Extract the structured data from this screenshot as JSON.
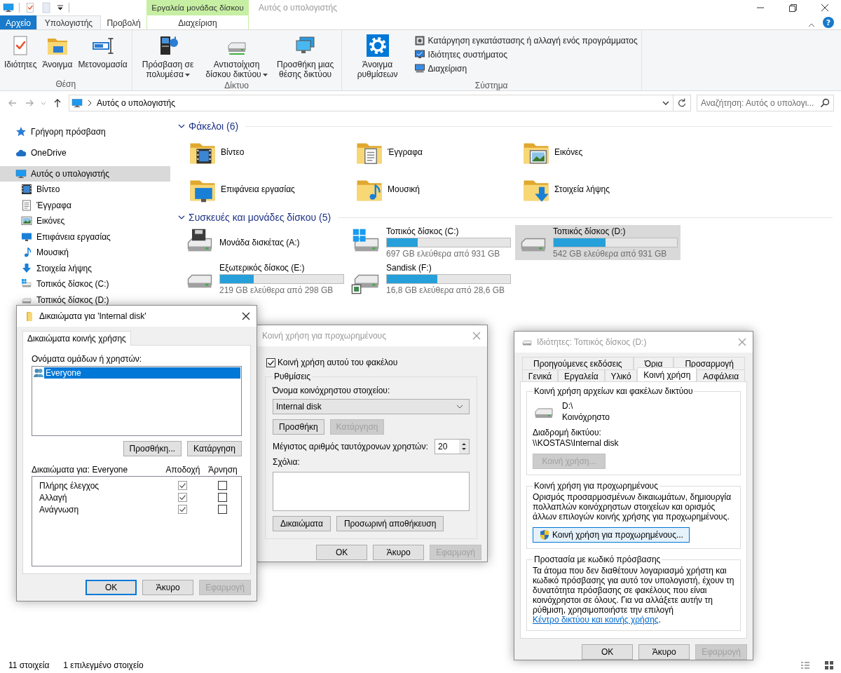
{
  "window": {
    "title": "Αυτός ο υπολογιστής",
    "tool_tab_group": "Εργαλεία μονάδας δίσκου",
    "help": "?"
  },
  "ribbon": {
    "tabs": [
      {
        "label": "Αρχείο",
        "kind": "file",
        "selected": false
      },
      {
        "label": "Υπολογιστής",
        "kind": "tab",
        "selected": true
      },
      {
        "label": "Προβολή",
        "kind": "tab",
        "selected": false
      },
      {
        "label": "Διαχείριση",
        "kind": "tool",
        "selected": false
      }
    ],
    "groups": [
      {
        "name": "Θέση",
        "commands": [
          {
            "label": "Ιδιότητες",
            "kind": "large",
            "dropdown": false
          },
          {
            "label": "Άνοιγμα",
            "kind": "large",
            "dropdown": false
          },
          {
            "label": "Μετονομασία",
            "kind": "large",
            "dropdown": false
          }
        ]
      },
      {
        "name": "Δίκτυο",
        "commands": [
          {
            "label": "Πρόσβαση σε πολυμέσα",
            "kind": "large",
            "dropdown": true
          },
          {
            "label": "Αντιστοίχιση δίσκου δικτύου",
            "kind": "large",
            "dropdown": true
          },
          {
            "label": "Προσθήκη μιας θέσης δικτύου",
            "kind": "large",
            "dropdown": false
          }
        ]
      },
      {
        "name": "Σύστημα",
        "commands": [
          {
            "label": "Άνοιγμα ρυθμίσεων",
            "kind": "large",
            "dropdown": false
          },
          {
            "label": "Κατάργηση εγκατάστασης ή αλλαγή ενός προγράμματος",
            "kind": "small"
          },
          {
            "label": "Ιδιότητες συστήματος",
            "kind": "small"
          },
          {
            "label": "Διαχείριση",
            "kind": "small"
          }
        ]
      }
    ]
  },
  "address_bar": {
    "path": "Αυτός ο υπολογιστής"
  },
  "search": {
    "placeholder": "Αναζήτηση: Αυτός ο υπολογι..."
  },
  "sidebar": {
    "items": [
      {
        "label": "Γρήγορη πρόσβαση",
        "selected": false
      },
      {
        "label": "OneDrive",
        "selected": false
      },
      {
        "label": "Αυτός ο υπολογιστής",
        "selected": true,
        "children": [
          {
            "label": "Βίντεο",
            "selected": false
          },
          {
            "label": "Έγγραφα",
            "selected": false
          },
          {
            "label": "Εικόνες",
            "selected": false
          },
          {
            "label": "Επιφάνεια εργασίας",
            "selected": false
          },
          {
            "label": "Μουσική",
            "selected": false
          },
          {
            "label": "Στοιχεία λήψης",
            "selected": false
          },
          {
            "label": "Τοπικός δίσκος (C:)",
            "selected": false
          },
          {
            "label": "Τοπικός δίσκος (D:)",
            "selected": false
          }
        ]
      }
    ]
  },
  "sections": [
    {
      "title": "Φάκελοι (6)",
      "kind": "folders",
      "items": [
        {
          "name": "Βίντεο"
        },
        {
          "name": "Έγγραφα"
        },
        {
          "name": "Εικόνες"
        },
        {
          "name": "Επιφάνεια εργασίας"
        },
        {
          "name": "Μουσική"
        },
        {
          "name": "Στοιχεία λήψης"
        }
      ]
    },
    {
      "title": "Συσκευές και μονάδες δίσκου (5)",
      "kind": "drives",
      "items": [
        {
          "name": "Μονάδα δισκέτας (A:)",
          "selected": false
        },
        {
          "name": "Τοπικός δίσκος (C:)",
          "level": 0.25,
          "free": "697 GB ελεύθερα από 931 GB",
          "selected": false
        },
        {
          "name": "Τοπικός δίσκος (D:)",
          "level": 0.42,
          "free": "542 GB ελεύθερα από 931 GB",
          "selected": true
        },
        {
          "name": "Εξωτερικός δίσκος (E:)",
          "level": 0.27,
          "free": "219 GB ελεύθερα από 298 GB",
          "selected": false
        },
        {
          "name": "Sandisk (F:)",
          "level": 0.41,
          "free": "16,8 GB ελεύθερα από 28,6 GB",
          "selected": false
        }
      ]
    }
  ],
  "status_bar": {
    "count": "11 στοιχεία",
    "selection": "1 επιλεγμένο στοιχείο"
  },
  "dialogs": [
    {
      "kind": "permissions",
      "title": "Δικαιώματα για 'Internal disk'",
      "active": true,
      "tabs": [
        {
          "label": "Δικαιώματα κοινής χρήσης",
          "selected": true
        }
      ],
      "users_label": "Ονόματα ομάδων ή χρηστών:",
      "users": [
        {
          "name": "Everyone",
          "selected": true
        }
      ],
      "user_buttons": [
        {
          "label": "Προσθήκη...",
          "disabled": false
        },
        {
          "label": "Κατάργηση",
          "disabled": false
        }
      ],
      "permissions_label": "Δικαιώματα για: Everyone",
      "columns": [
        "Αποδοχή",
        "Άρνηση"
      ],
      "permissions": [
        {
          "name": "Πλήρης έλεγχος",
          "allow": true,
          "deny": false
        },
        {
          "name": "Αλλαγή",
          "allow": true,
          "deny": false
        },
        {
          "name": "Ανάγνωση",
          "allow": true,
          "deny": false
        }
      ],
      "buttons": [
        {
          "label": "OK",
          "default": true,
          "disabled": false
        },
        {
          "label": "Άκυρο",
          "default": false,
          "disabled": false
        },
        {
          "label": "Εφαρμογή",
          "default": false,
          "disabled": true
        }
      ]
    },
    {
      "kind": "advanced_sharing",
      "title": "Κοινή χρήση για προχωρημένους",
      "active": false,
      "share_checkbox": {
        "label": "Κοινή χρήση αυτού του φακέλου",
        "checked": true
      },
      "settings_group": "Ρυθμίσεις",
      "share_name_label": "Όνομα κοινόχρηστου στοιχείου:",
      "share_name": "Internal disk",
      "share_buttons": [
        {
          "label": "Προσθήκη",
          "disabled": false
        },
        {
          "label": "Κατάργηση",
          "disabled": true
        }
      ],
      "user_limit_label": "Μέγιστος αριθμός ταυτόχρονων χρηστών:",
      "user_limit": "20",
      "comments_label": "Σχόλια:",
      "option_buttons": [
        {
          "label": "Δικαιώματα",
          "disabled": false
        },
        {
          "label": "Προσωρινή αποθήκευση",
          "disabled": false
        }
      ],
      "buttons": [
        {
          "label": "OK",
          "default": false,
          "disabled": false
        },
        {
          "label": "Άκυρο",
          "default": false,
          "disabled": false
        },
        {
          "label": "Εφαρμογή",
          "default": false,
          "disabled": true
        }
      ]
    },
    {
      "kind": "properties",
      "title": "Ιδιότητες: Τοπικός δίσκος (D:)",
      "active": false,
      "tab_rows": [
        [
          {
            "label": "Προηγούμενες εκδόσεις",
            "selected": false
          },
          {
            "label": "Όρια",
            "selected": false
          },
          {
            "label": "Προσαρμογή",
            "selected": false
          }
        ],
        [
          {
            "label": "Γενικά",
            "selected": false
          },
          {
            "label": "Εργαλεία",
            "selected": false
          },
          {
            "label": "Υλικό",
            "selected": false
          },
          {
            "label": "Κοινή χρήση",
            "selected": true
          },
          {
            "label": "Ασφάλεια",
            "selected": false
          }
        ]
      ],
      "network_sharing": {
        "title": "Κοινή χρήση αρχείων και φακέλων δικτύου",
        "drive": "D:\\",
        "status": "Κοινόχρηστο",
        "path_label": "Διαδρομή δικτύου:",
        "path": "\\\\KOSTAS\\Internal disk",
        "button": {
          "label": "Κοινή χρήση...",
          "disabled": true
        }
      },
      "advanced_sharing": {
        "title": "Κοινή χρήση για προχωρημένους",
        "description": "Ορισμός προσαρμοσμένων δικαιωμάτων, δημιουργία πολλαπλών κοινόχρηστων στοιχείων και ορισμός άλλων επιλογών κοινής χρήσης για προχωρημένους.",
        "button": {
          "label": "Κοινή χρήση για προχωρημένους...",
          "disabled": false
        }
      },
      "password_protection": {
        "title": "Προστασία με κωδικό πρόσβασης",
        "text": "Τα άτομα που δεν διαθέτουν λογαριασμό χρήστη και κωδικό πρόσβασης για αυτό τον υπολογιστή, έχουν τη δυνατότητα πρόσβασης σε φακέλους που είναι κοινόχρηστοι σε όλους. Για να αλλάξετε αυτήν τη ρύθμιση, χρησιμοποιήστε την επιλογή",
        "link": "Κέντρο δικτύου και κοινής χρήσης",
        "after": "."
      },
      "buttons": [
        {
          "label": "OK",
          "default": false,
          "disabled": false
        },
        {
          "label": "Άκυρο",
          "default": false,
          "disabled": false
        },
        {
          "label": "Εφαρμογή",
          "default": false,
          "disabled": true
        }
      ]
    }
  ]
}
